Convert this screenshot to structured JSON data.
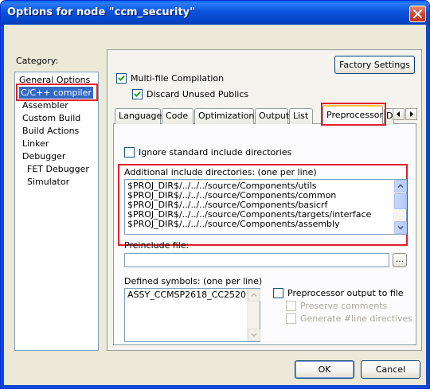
{
  "window": {
    "title": "Options for node \"ccm_security\""
  },
  "category": {
    "label": "Category:",
    "items": [
      {
        "label": "General Options",
        "selected": false,
        "indent": 0
      },
      {
        "label": "C/C++ compiler",
        "selected": true,
        "indent": 0
      },
      {
        "label": "Assembler",
        "selected": false,
        "indent": 0
      },
      {
        "label": "Custom Build",
        "selected": false,
        "indent": 0
      },
      {
        "label": "Build Actions",
        "selected": false,
        "indent": 0
      },
      {
        "label": "Linker",
        "selected": false,
        "indent": 0
      },
      {
        "label": "Debugger",
        "selected": false,
        "indent": 0
      },
      {
        "label": "FET Debugger",
        "selected": false,
        "indent": 1
      },
      {
        "label": "Simulator",
        "selected": false,
        "indent": 1
      }
    ]
  },
  "factory_settings_label": "Factory Settings",
  "multifile": {
    "label": "Multi-file Compilation",
    "checked": true,
    "discard_label": "Discard Unused Publics",
    "discard_checked": true
  },
  "tabs": [
    {
      "label": "Language",
      "active": false
    },
    {
      "label": "Code",
      "active": false
    },
    {
      "label": "Optimizations",
      "active": false
    },
    {
      "label": "Output",
      "active": false
    },
    {
      "label": "List",
      "active": false
    },
    {
      "label": "Preprocessor",
      "active": true
    },
    {
      "label": "D",
      "active": false
    }
  ],
  "preprocessor": {
    "ignore_std_label": "Ignore standard include directories",
    "ignore_std_checked": false,
    "additional_include_label": "Additional include directories: (one per line)",
    "include_dirs": [
      "$PROJ_DIR$/../../../source/Components/utils",
      "$PROJ_DIR$/../../../source/Components/common",
      "$PROJ_DIR$/../../../source/Components/basicrf",
      "$PROJ_DIR$/../../../source/Components/targets/interface",
      "$PROJ_DIR$/../../../source/Components/assembly"
    ],
    "preinclude_label": "Preinclude file:",
    "preinclude_value": "",
    "browse_label": "...",
    "defined_symbols_label": "Defined symbols: (one per line)",
    "defined_symbols": [
      "ASSY_CCMSP2618_CC2520"
    ],
    "pp_output_label": "Preprocessor output to file",
    "pp_output_checked": false,
    "preserve_comments_label": "Preserve comments",
    "generate_line_label": "Generate #line directives"
  },
  "footer": {
    "ok_label": "OK",
    "cancel_label": "Cancel"
  },
  "colors": {
    "title_bar": "#0a53dc",
    "highlight": "#e0202a",
    "selection": "#316ac5"
  }
}
